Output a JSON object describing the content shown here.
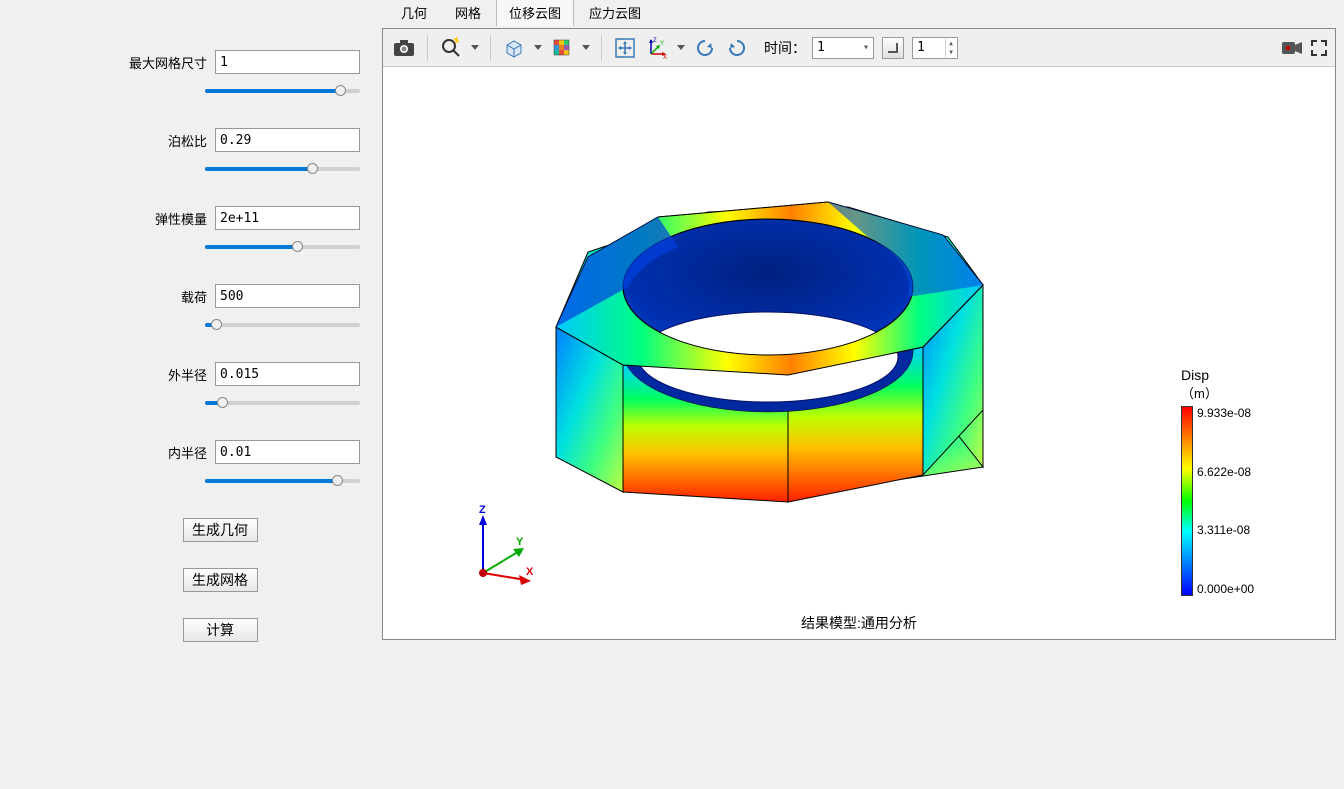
{
  "params": {
    "mesh_size_label": "最大网格尺寸",
    "mesh_size_value": "1",
    "poisson_label": "泊松比",
    "poisson_value": "0.29",
    "modulus_label": "弹性模量",
    "modulus_value": "2e+11",
    "load_label": "载荷",
    "load_value": "500",
    "outer_r_label": "外半径",
    "outer_r_value": "0.015",
    "inner_r_label": "内半径",
    "inner_r_value": "0.01"
  },
  "buttons": {
    "gen_geom": "生成几何",
    "gen_mesh": "生成网格",
    "compute": "计算"
  },
  "tabs": {
    "geometry": "几何",
    "mesh": "网格",
    "disp_cloud": "位移云图",
    "stress_cloud": "应力云图"
  },
  "toolbar": {
    "time_label": "时间：",
    "time_value": "1",
    "step_value": "1"
  },
  "viewport": {
    "caption": "结果模型:通用分析",
    "axis_x": "X",
    "axis_y": "Y",
    "axis_z": "Z"
  },
  "legend": {
    "title": "Disp",
    "unit": "（m）",
    "v0": "9.933e-08",
    "v1": "6.622e-08",
    "v2": "3.311e-08",
    "v3": "0.000e+00"
  }
}
